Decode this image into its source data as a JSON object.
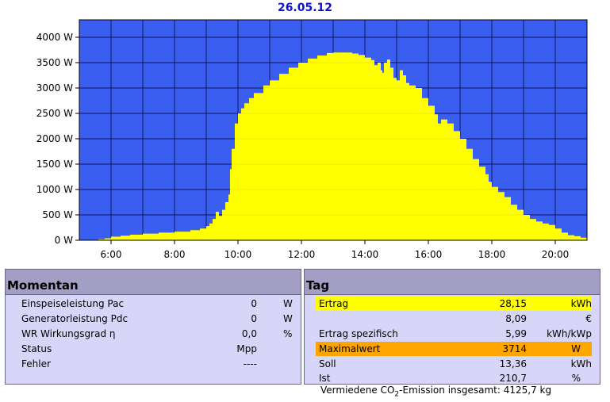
{
  "title": "26.05.12",
  "colors": {
    "plot_bg": "#3a5ff0",
    "area": "#ffff00",
    "grid": "#101050",
    "highlight_yellow": "#ffff00",
    "highlight_orange": "#ffa500"
  },
  "chart_data": {
    "type": "area",
    "title": "26.05.12",
    "xlabel": "",
    "ylabel": "",
    "xlim": [
      5.0,
      21.0
    ],
    "ylim": [
      0,
      4000
    ],
    "x_ticks": [
      "6:00",
      "8:00",
      "10:00",
      "12:00",
      "14:00",
      "16:00",
      "18:00",
      "20:00"
    ],
    "y_ticks": [
      "4000 W",
      "3500 W",
      "3000 W",
      "2500 W",
      "2000 W",
      "1500 W",
      "1000 W",
      "500 W",
      "0 W"
    ],
    "grid": true,
    "series": [
      {
        "values": [
          [
            5.5,
            0
          ],
          [
            5.6,
            20
          ],
          [
            5.8,
            40
          ],
          [
            6.0,
            70
          ],
          [
            6.3,
            90
          ],
          [
            6.6,
            110
          ],
          [
            7.0,
            130
          ],
          [
            7.5,
            150
          ],
          [
            8.0,
            170
          ],
          [
            8.5,
            200
          ],
          [
            8.8,
            230
          ],
          [
            9.0,
            280
          ],
          [
            9.1,
            330
          ],
          [
            9.2,
            420
          ],
          [
            9.3,
            560
          ],
          [
            9.4,
            480
          ],
          [
            9.5,
            600
          ],
          [
            9.6,
            750
          ],
          [
            9.7,
            900
          ],
          [
            9.75,
            1400
          ],
          [
            9.8,
            1800
          ],
          [
            9.9,
            2300
          ],
          [
            10.0,
            2500
          ],
          [
            10.1,
            2600
          ],
          [
            10.2,
            2700
          ],
          [
            10.35,
            2800
          ],
          [
            10.5,
            2900
          ],
          [
            10.8,
            3050
          ],
          [
            11.0,
            3150
          ],
          [
            11.3,
            3280
          ],
          [
            11.6,
            3400
          ],
          [
            11.9,
            3500
          ],
          [
            12.2,
            3580
          ],
          [
            12.5,
            3640
          ],
          [
            12.8,
            3690
          ],
          [
            13.0,
            3700
          ],
          [
            13.3,
            3700
          ],
          [
            13.6,
            3680
          ],
          [
            13.8,
            3650
          ],
          [
            14.0,
            3600
          ],
          [
            14.2,
            3550
          ],
          [
            14.3,
            3450
          ],
          [
            14.4,
            3500
          ],
          [
            14.5,
            3350
          ],
          [
            14.55,
            3300
          ],
          [
            14.6,
            3500
          ],
          [
            14.7,
            3560
          ],
          [
            14.8,
            3400
          ],
          [
            14.9,
            3200
          ],
          [
            15.0,
            3150
          ],
          [
            15.1,
            3350
          ],
          [
            15.2,
            3250
          ],
          [
            15.3,
            3100
          ],
          [
            15.4,
            3050
          ],
          [
            15.6,
            3000
          ],
          [
            15.8,
            2800
          ],
          [
            16.0,
            2650
          ],
          [
            16.2,
            2480
          ],
          [
            16.3,
            2300
          ],
          [
            16.4,
            2380
          ],
          [
            16.6,
            2300
          ],
          [
            16.8,
            2150
          ],
          [
            17.0,
            2000
          ],
          [
            17.2,
            1800
          ],
          [
            17.4,
            1600
          ],
          [
            17.6,
            1450
          ],
          [
            17.8,
            1300
          ],
          [
            17.9,
            1150
          ],
          [
            18.0,
            1050
          ],
          [
            18.2,
            950
          ],
          [
            18.4,
            850
          ],
          [
            18.6,
            700
          ],
          [
            18.8,
            600
          ],
          [
            19.0,
            500
          ],
          [
            19.2,
            420
          ],
          [
            19.4,
            370
          ],
          [
            19.6,
            330
          ],
          [
            19.8,
            300
          ],
          [
            20.0,
            230
          ],
          [
            20.2,
            150
          ],
          [
            20.4,
            100
          ],
          [
            20.6,
            80
          ],
          [
            20.8,
            50
          ],
          [
            21.0,
            20
          ]
        ]
      }
    ]
  },
  "momentan": {
    "header": "Momentan",
    "rows": [
      {
        "label": "Einspeiseleistung Pac",
        "value": "0",
        "unit": "W"
      },
      {
        "label": "Generatorleistung Pdc",
        "value": "0",
        "unit": "W"
      },
      {
        "label": "WR Wirkungsgrad η",
        "value": "0,0",
        "unit": "%"
      },
      {
        "label": "Status",
        "value": "Mpp",
        "unit": ""
      },
      {
        "label": "Fehler",
        "value": "----",
        "unit": ""
      }
    ]
  },
  "tag": {
    "header": "Tag",
    "rows": [
      {
        "label": "Ertrag",
        "value": "28,15",
        "unit": "kWh",
        "highlight": "yellow"
      },
      {
        "label": "",
        "value": "8,09",
        "unit": "€",
        "highlight": ""
      },
      {
        "label": "Ertrag spezifisch",
        "value": "5,99",
        "unit": "kWh/kWp",
        "highlight": ""
      },
      {
        "label": "Maximalwert",
        "value": "3714",
        "unit": "W",
        "highlight": "orange"
      },
      {
        "label": "Soll",
        "value": "13,36",
        "unit": "kWh",
        "highlight": ""
      },
      {
        "label": "Ist",
        "value": "210,7",
        "unit": "%",
        "highlight": ""
      }
    ]
  },
  "footer": {
    "co2_prefix": "Vermiedene CO",
    "co2_sub": "2",
    "co2_suffix": "-Emission insgesamt: 4125,7 kg"
  }
}
